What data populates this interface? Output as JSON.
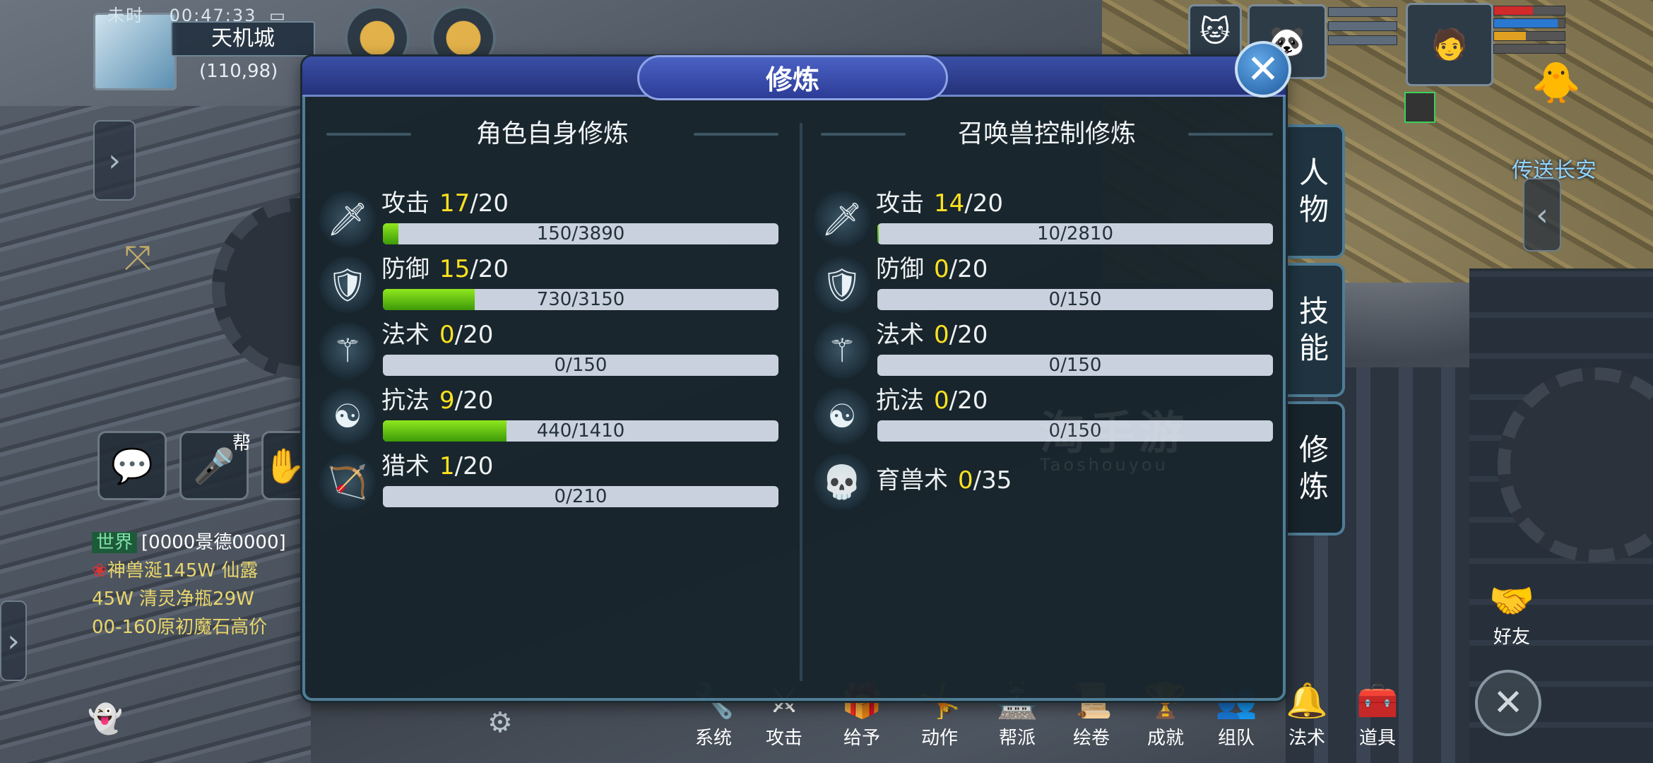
{
  "hud": {
    "time_label": "未时",
    "clock": "00:47:33",
    "location_name": "天机城",
    "coordinates": "(110,98)",
    "teleport_text": "传送长安",
    "friend_label": "好友",
    "guild_badge": "帮"
  },
  "chat": {
    "channel": "世界",
    "lines": [
      "[0000景德0000]",
      "神兽涎145W 仙露",
      "45W 清灵净瓶29W",
      "00-160原初魔石高价"
    ]
  },
  "toolbar": {
    "items": [
      "系统",
      "攻击",
      "给予",
      "动作",
      "帮派",
      "绘卷",
      "成就",
      "组队",
      "法术",
      "道具"
    ]
  },
  "panel": {
    "title": "修炼",
    "tabs": [
      "人物",
      "技能",
      "修炼"
    ],
    "active_tab": "修炼",
    "left": {
      "heading": "角色自身修炼",
      "rows": [
        {
          "icon": "sword-icon",
          "name": "攻击",
          "level": "17",
          "max": "/20",
          "progress_text": "150/3890",
          "fraction": 0.0386
        },
        {
          "icon": "shield-icon",
          "name": "防御",
          "level": "15",
          "max": "/20",
          "progress_text": "730/3150",
          "fraction": 0.2317
        },
        {
          "icon": "staff-icon",
          "name": "法术",
          "level": "0",
          "max": "/20",
          "progress_text": "0/150",
          "fraction": 0
        },
        {
          "icon": "yin-yang-icon",
          "name": "抗法",
          "level": "9",
          "max": "/20",
          "progress_text": "440/1410",
          "fraction": 0.312
        },
        {
          "icon": "bow-icon",
          "name": "猎术",
          "level": "1",
          "max": "/20",
          "progress_text": "0/210",
          "fraction": 0
        }
      ]
    },
    "right": {
      "heading": "召唤兽控制修炼",
      "rows": [
        {
          "icon": "sword-icon",
          "name": "攻击",
          "level": "14",
          "max": "/20",
          "progress_text": "10/2810",
          "fraction": 0.0036
        },
        {
          "icon": "shield-icon",
          "name": "防御",
          "level": "0",
          "max": "/20",
          "progress_text": "0/150",
          "fraction": 0
        },
        {
          "icon": "staff-icon",
          "name": "法术",
          "level": "0",
          "max": "/20",
          "progress_text": "0/150",
          "fraction": 0
        },
        {
          "icon": "yin-yang-icon",
          "name": "抗法",
          "level": "0",
          "max": "/20",
          "progress_text": "0/150",
          "fraction": 0
        }
      ],
      "extra": {
        "icon": "beast-skull-icon",
        "name": "育兽术",
        "level": "0",
        "max": "/35"
      }
    }
  },
  "watermark": {
    "main": "淘手游",
    "sub": "Taoshouyou"
  },
  "colors": {
    "level_value": "#ffe21f",
    "bar_fill": "#6cc514",
    "title_bar": "#3346a0",
    "panel_border": "#4f7d96"
  }
}
